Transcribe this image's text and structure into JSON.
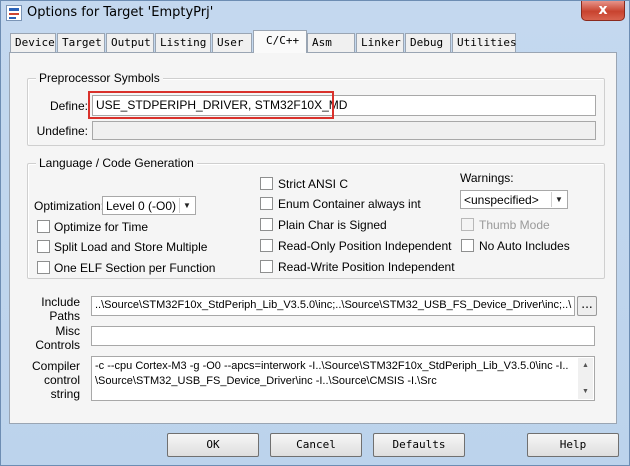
{
  "window": {
    "title": "Options for Target 'EmptyPrj'",
    "close_label": "x"
  },
  "tabs": [
    "Device",
    "Target",
    "Output",
    "Listing",
    "User",
    "C/C++",
    "Asm",
    "Linker",
    "Debug",
    "Utilities"
  ],
  "preprocessor": {
    "title": "Preprocessor Symbols",
    "define_label": "Define:",
    "define_value": "USE_STDPERIPH_DRIVER, STM32F10X_MD",
    "undefine_label": "Undefine:",
    "undefine_value": ""
  },
  "language": {
    "title": "Language / Code Generation",
    "optimization_label": "Optimization:",
    "optimization_value": "Level 0 (-O0)",
    "optimize_time": "Optimize for Time",
    "split_load": "Split Load and Store Multiple",
    "one_elf": "One ELF Section per Function",
    "strict_ansi": "Strict ANSI C",
    "enum_container": "Enum Container always int",
    "plain_char": "Plain Char is Signed",
    "ro_pos": "Read-Only Position Independent",
    "rw_pos": "Read-Write Position Independent",
    "warnings_label": "Warnings:",
    "warnings_value": "<unspecified>",
    "thumb_mode": "Thumb Mode",
    "no_auto_includes": "No Auto Includes"
  },
  "include": {
    "label_line1": "Include",
    "label_line2": "Paths",
    "value": "..\\Source\\STM32F10x_StdPeriph_Lib_V3.5.0\\inc;..\\Source\\STM32_USB_FS_Device_Driver\\inc;..\\",
    "browse_label": "..."
  },
  "misc": {
    "label_line1": "Misc",
    "label_line2": "Controls",
    "value": ""
  },
  "compiler": {
    "label_line1": "Compiler",
    "label_line2": "control",
    "label_line3": "string",
    "line1": "-c --cpu Cortex-M3 -g -O0 --apcs=interwork -I..\\Source\\STM32F10x_StdPeriph_Lib_V3.5.0\\inc -I..",
    "line2": "\\Source\\STM32_USB_FS_Device_Driver\\inc -I..\\Source\\CMSIS -I.\\Src"
  },
  "buttons": {
    "ok": "OK",
    "cancel": "Cancel",
    "defaults": "Defaults",
    "help": "Help"
  },
  "colors": {
    "highlight": "#d9312b",
    "close": "#c8432f"
  }
}
